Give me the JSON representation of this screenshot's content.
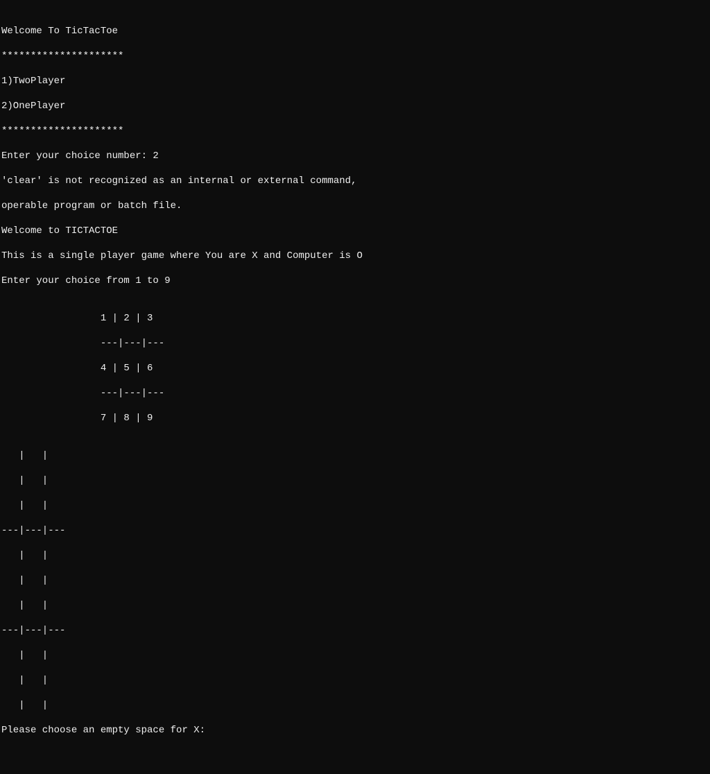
{
  "title": "Welcome To TicTacToe",
  "divider": "*********************",
  "menu": {
    "option1": "1)TwoPlayer",
    "option2": "2)OnePlayer"
  },
  "divider2": "*********************",
  "prompt_choice": "Enter your choice number: 2",
  "error_line1": "'clear' is not recognized as an internal or external command,",
  "error_line2": "operable program or batch file.",
  "welcome2": "Welcome to TICTACTOE",
  "desc": "This is a single player game where You are X and Computer is O",
  "prompt_range": "Enter your choice from 1 to 9",
  "blank": "",
  "guide": {
    "row1": "                 1 | 2 | 3 ",
    "sep1": "                 ---|---|---",
    "row2": "                 4 | 5 | 6 ",
    "sep2": "                 ---|---|---",
    "row3": "                 7 | 8 | 9 "
  },
  "board": {
    "r1a": "   |   |   ",
    "r1b": "   |   |   ",
    "r1c": "   |   |   ",
    "sep1": "---|---|---",
    "r2a": "   |   |   ",
    "r2b": "   |   |   ",
    "r2c": "   |   |   ",
    "sep2": "---|---|---",
    "r3a": "   |   |   ",
    "r3b": "   |   |   ",
    "r3c": "   |   |   "
  },
  "prompt_move": "Please choose an empty space for X:"
}
